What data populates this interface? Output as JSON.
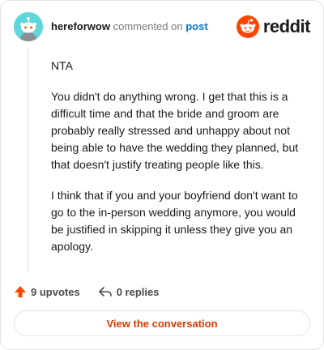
{
  "comment": {
    "username": "hereforwow",
    "action_text": "commented on",
    "target_link": "post",
    "paragraphs": [
      "NTA",
      "You didn't do anything wrong. I get that this is a difficult time and that the bride and groom are probably really stressed and unhappy about not being able to have the wedding they planned, but that doesn't justify treating people like this.",
      "I think that if you and your boyfriend don't want to go to the in-person wedding anymore, you would be justified in skipping it unless they give you an apology."
    ]
  },
  "brand": {
    "name": "reddit",
    "icon": "reddit-snoo-icon",
    "color": "#ff4500"
  },
  "footer": {
    "upvotes_label": "9 upvotes",
    "replies_label": "0 replies",
    "view_button_label": "View the conversation",
    "upvote_icon": "upvote-arrow-icon",
    "reply_icon": "reply-arrow-icon"
  },
  "colors": {
    "accent": "#d93a00",
    "link": "#0079d3",
    "avatar_bg": "#5fd6d9"
  }
}
